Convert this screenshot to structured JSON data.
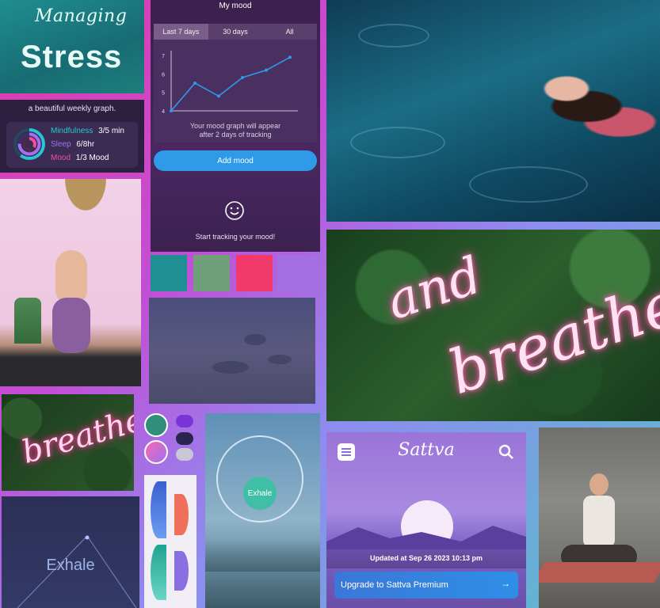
{
  "stress_tile": {
    "line1": "Managing",
    "line2": "Stress"
  },
  "weekly_card": {
    "caption": "a beautiful weekly graph.",
    "rows": [
      {
        "label": "Mindfulness",
        "value": "3/5 min",
        "color": "#27c6d4"
      },
      {
        "label": "Sleep",
        "value": "6/8hr",
        "color": "#a56ff0"
      },
      {
        "label": "Mood",
        "value": "1/3 Mood",
        "color": "#f0509f"
      }
    ]
  },
  "mood_screen": {
    "header": "My mood",
    "tabs": [
      "Last 7 days",
      "30 days",
      "All"
    ],
    "active_tab": "Last 7 days",
    "y_ticks": [
      "7",
      "6",
      "5",
      "4"
    ],
    "note_line1": "Your mood graph will appear",
    "note_line2": "after 2 days of tracking",
    "add_button": "Add mood",
    "start_label": "Start tracking your mood!",
    "accent": "#2e9ae8"
  },
  "chart_data": {
    "type": "line",
    "x": [
      1,
      2,
      3,
      4,
      5,
      6
    ],
    "values": [
      4.0,
      5.5,
      4.8,
      5.8,
      6.2,
      6.9
    ],
    "ylim": [
      4,
      7
    ],
    "yticks": [
      4,
      5,
      6,
      7
    ]
  },
  "palette": [
    "#1f8f94",
    "#6fa07a",
    "#f23a6a",
    "#a46fe0"
  ],
  "neon_big": {
    "word1": "and",
    "word2": "breathe"
  },
  "neon_small": {
    "word": "breathe"
  },
  "exhale_dark": {
    "label": "Exhale"
  },
  "exhale_phone": {
    "label": "Exhale"
  },
  "sattva": {
    "logo": "Sattva",
    "updated": "Updated at Sep 26 2023 10:13 pm",
    "button": "Upgrade to Sattva Premium",
    "arrow": "→"
  }
}
